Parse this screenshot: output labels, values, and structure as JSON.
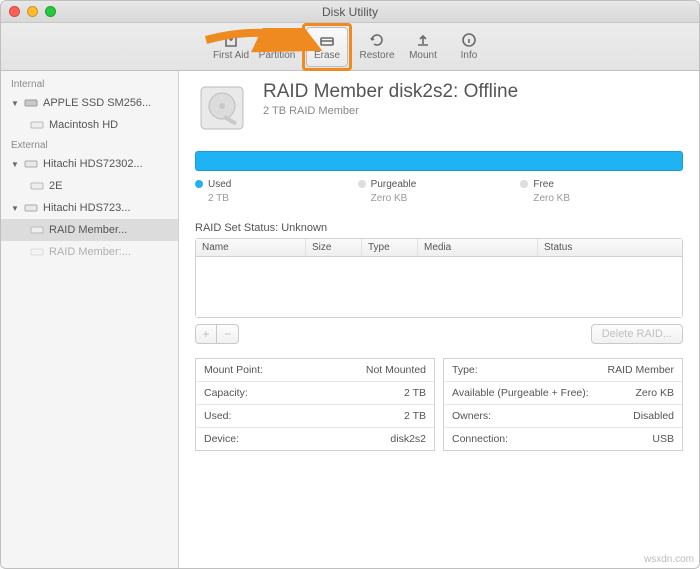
{
  "window": {
    "title": "Disk Utility"
  },
  "toolbar": {
    "first_aid": "First Aid",
    "partition": "Partition",
    "erase": "Erase",
    "restore": "Restore",
    "mount": "Mount",
    "info": "Info"
  },
  "sidebar": {
    "internal_label": "Internal",
    "external_label": "External",
    "items": {
      "apple_ssd": "APPLE SSD SM256...",
      "macintosh_hd": "Macintosh HD",
      "hitachi1": "Hitachi HDS72302...",
      "vol_2e": "2E",
      "hitachi2": "Hitachi HDS723...",
      "raid_member_sel": "RAID Member...",
      "raid_member_dim": "RAID Member:..."
    }
  },
  "header": {
    "title": "RAID Member disk2s2: Offline",
    "subtitle": "2 TB RAID Member"
  },
  "usage": {
    "used_label": "Used",
    "used_val": "2 TB",
    "purgeable_label": "Purgeable",
    "purgeable_val": "Zero KB",
    "free_label": "Free",
    "free_val": "Zero KB"
  },
  "raid": {
    "status_label": "RAID Set Status: Unknown",
    "cols": {
      "name": "Name",
      "size": "Size",
      "type": "Type",
      "media": "Media",
      "status": "Status"
    },
    "delete_btn": "Delete RAID..."
  },
  "info": {
    "left": {
      "mount_point_k": "Mount Point:",
      "mount_point_v": "Not Mounted",
      "capacity_k": "Capacity:",
      "capacity_v": "2 TB",
      "used_k": "Used:",
      "used_v": "2 TB",
      "device_k": "Device:",
      "device_v": "disk2s2"
    },
    "right": {
      "type_k": "Type:",
      "type_v": "RAID Member",
      "avail_k": "Available (Purgeable + Free):",
      "avail_v": "Zero KB",
      "owners_k": "Owners:",
      "owners_v": "Disabled",
      "conn_k": "Connection:",
      "conn_v": "USB"
    }
  },
  "watermark": "wsxdn.com"
}
